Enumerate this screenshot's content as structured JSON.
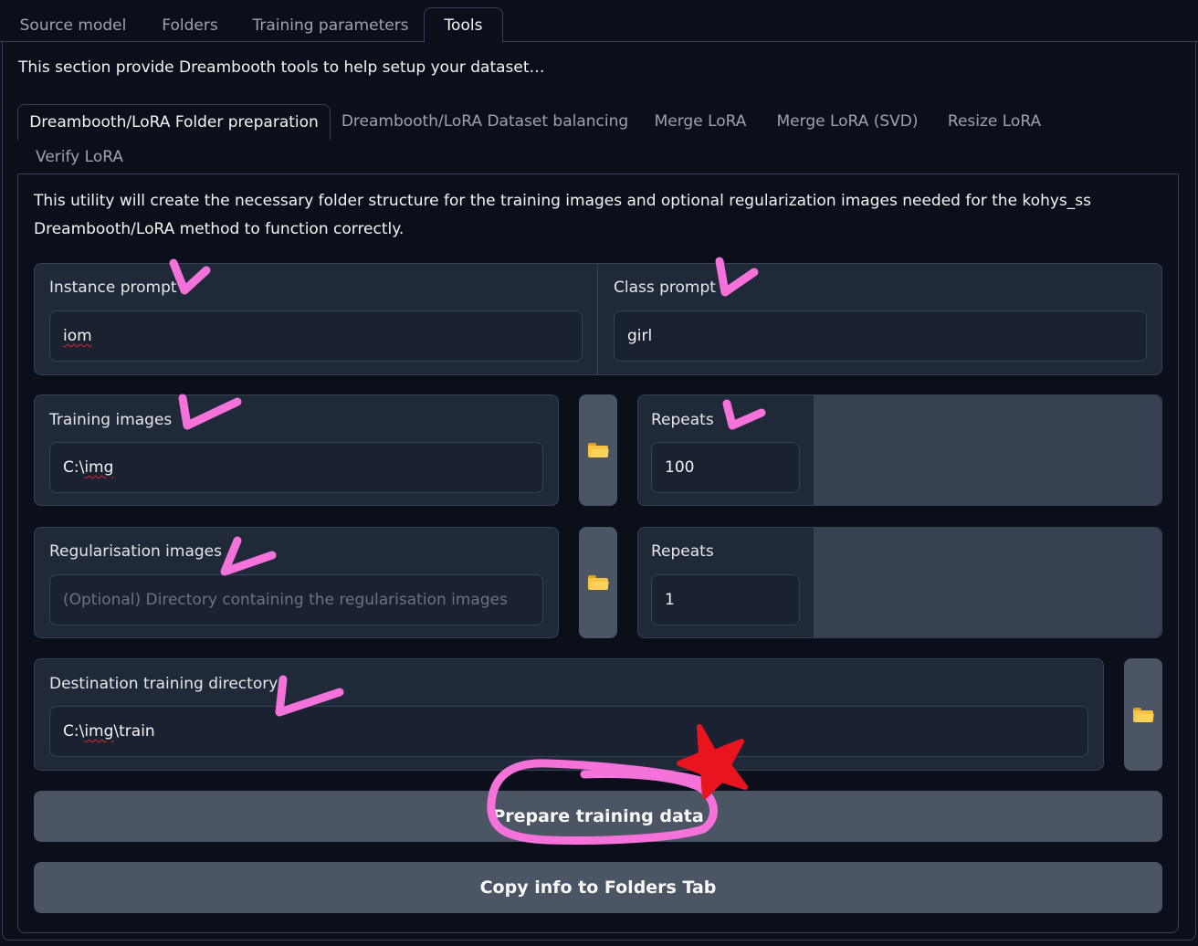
{
  "top_tabs": [
    {
      "label": "Source model"
    },
    {
      "label": "Folders"
    },
    {
      "label": "Training parameters"
    },
    {
      "label": "Tools",
      "active": true
    }
  ],
  "tools": {
    "description": "This section provide Dreambooth tools to help setup your dataset…",
    "sub_tabs": [
      {
        "label": "Dreambooth/LoRA Folder preparation",
        "active": true
      },
      {
        "label": "Dreambooth/LoRA Dataset balancing"
      },
      {
        "label": "Merge LoRA"
      },
      {
        "label": "Merge LoRA (SVD)"
      },
      {
        "label": "Resize LoRA"
      },
      {
        "label": "Verify LoRA"
      }
    ]
  },
  "folder_prep": {
    "utility_text": "This utility will create the necessary folder structure for the training images and optional regularization images needed for the kohys_ss Dreambooth/LoRA method to function correctly.",
    "instance_prompt": {
      "label": "Instance prompt",
      "value": "iom"
    },
    "class_prompt": {
      "label": "Class prompt",
      "value": "girl"
    },
    "training_images": {
      "label": "Training images",
      "value_prefix": "C:\\",
      "value_word": "img"
    },
    "training_repeats": {
      "label": "Repeats",
      "value": "100"
    },
    "reg_images": {
      "label": "Regularisation images",
      "placeholder": "(Optional) Directory containing the regularisation images"
    },
    "reg_repeats": {
      "label": "Repeats",
      "value": "1"
    },
    "destination": {
      "label": "Destination training directory",
      "value_prefix": "C:\\",
      "value_word": "img",
      "value_suffix": "\\train"
    },
    "prepare_button": "Prepare training data",
    "copy_button": "Copy info to Folders Tab"
  },
  "icons": {
    "folder": "folder-icon"
  },
  "colors": {
    "annotation_pink": "#f472d9",
    "annotation_red": "#e8141e",
    "background": "#0b0f19",
    "block": "#1f2937",
    "button": "#4b5563"
  }
}
